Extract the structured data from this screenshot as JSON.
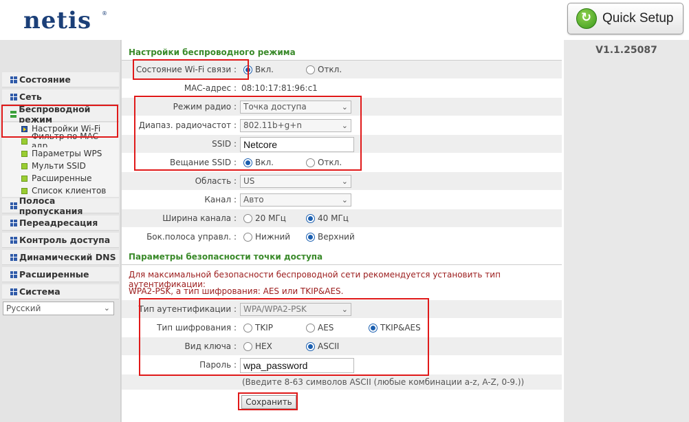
{
  "header": {
    "logo": "netis",
    "logo_mark": "®",
    "quick_setup": "Quick Setup"
  },
  "version": "V1.1.25087",
  "sidebar": {
    "items": [
      {
        "label": "Состояние"
      },
      {
        "label": "Сеть"
      },
      {
        "label": "Беспроводной режим"
      },
      {
        "label": "Полоса пропускания"
      },
      {
        "label": "Переадресация"
      },
      {
        "label": "Контроль доступа"
      },
      {
        "label": "Динамический DNS"
      },
      {
        "label": "Расширенные"
      },
      {
        "label": "Система"
      }
    ],
    "subitems": [
      {
        "label": "Настройки Wi-Fi"
      },
      {
        "label": "Фильтр по MAC-адр."
      },
      {
        "label": "Параметры WPS"
      },
      {
        "label": "Мульти SSID"
      },
      {
        "label": "Расширенные"
      },
      {
        "label": "Список клиентов"
      }
    ],
    "language": "Русский"
  },
  "wireless": {
    "title": "Настройки беспроводного режима",
    "wifi_status": {
      "label": "Состояние Wi-Fi связи :",
      "on": "Вкл.",
      "off": "Откл."
    },
    "mac": {
      "label": "MAC-адрес :",
      "value": "08:10:17:81:96:c1"
    },
    "radio_mode": {
      "label": "Режим радио :",
      "value": "Точка доступа"
    },
    "band": {
      "label": "Диапаз. радиочастот :",
      "value": "802.11b+g+n"
    },
    "ssid": {
      "label": "SSID :",
      "value": "Netcore"
    },
    "ssid_broadcast": {
      "label": "Вещание SSID :",
      "on": "Вкл.",
      "off": "Откл."
    },
    "region": {
      "label": "Область :",
      "value": "US"
    },
    "channel": {
      "label": "Канал :",
      "value": "Авто"
    },
    "channel_width": {
      "label": "Ширина канала :",
      "opt1": "20 МГц",
      "opt2": "40 МГц"
    },
    "sideband": {
      "label": "Бок.полоса управл. :",
      "opt1": "Нижний",
      "opt2": "Верхний"
    }
  },
  "security": {
    "title": "Параметры безопасности точки доступа",
    "notice1": "Для максимальной безопасности беспроводной сети рекомендуется установить тип аутентификации:",
    "notice2": "WPA2-PSK, а тип шифрования: AES или TKIP&AES.",
    "auth": {
      "label": "Тип аутентификации :",
      "value": "WPA/WPA2-PSK"
    },
    "cipher": {
      "label": "Тип шифрования :",
      "opt1": "TKIP",
      "opt2": "AES",
      "opt3": "TKIP&AES"
    },
    "key_type": {
      "label": "Вид ключа :",
      "opt1": "HEX",
      "opt2": "ASCII"
    },
    "password": {
      "label": "Пароль :",
      "value": "wpa_password"
    },
    "hint": "(Введите 8-63 символов ASCII (любые комбинации a-z, A-Z, 0-9.))",
    "save": "Сохранить"
  },
  "colors": {
    "accent_green": "#3a8a2a",
    "notice_red": "#9b1b1b",
    "highlight_red": "#e01818",
    "logo_blue": "#1b3f78"
  }
}
